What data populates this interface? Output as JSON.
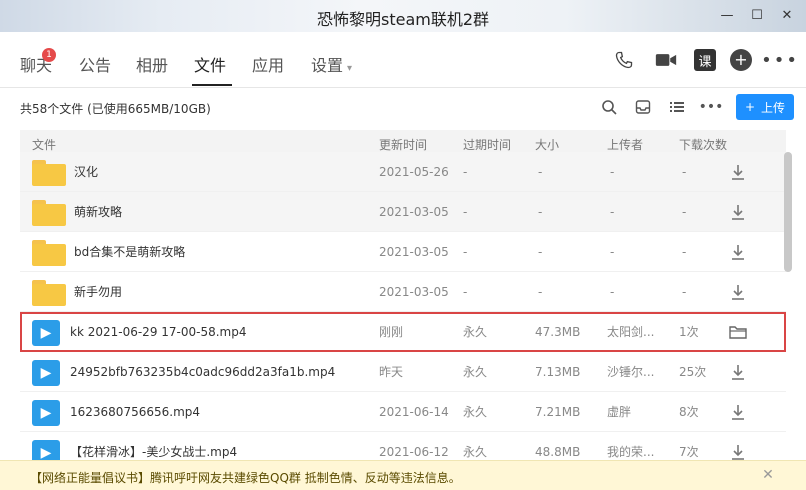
{
  "window": {
    "title": "恐怖黎明steam联机2群",
    "controls": [
      "minimize-icon",
      "maximize-icon",
      "close-icon"
    ]
  },
  "tabs": [
    {
      "label": "聊天",
      "badge": "1",
      "active": false
    },
    {
      "label": "公告",
      "active": false
    },
    {
      "label": "相册",
      "active": false
    },
    {
      "label": "文件",
      "active": true
    },
    {
      "label": "应用",
      "active": false
    },
    {
      "label": "设置",
      "active": false,
      "dropdown": true
    }
  ],
  "header_icons": {
    "phone": "phone-icon",
    "video": "video-call-icon",
    "course": {
      "icon": "course-icon",
      "label": "课"
    },
    "add": "plus-circle-icon",
    "more": "more-icon"
  },
  "toolbar": {
    "summary": "共58个文件 (已使用665MB/10GB)",
    "upload_label": "上传",
    "tools": [
      "search-icon",
      "inbox-icon",
      "list-view-icon",
      "more-icon"
    ]
  },
  "columns": {
    "file": "文件",
    "updated": "更新时间",
    "expire": "过期时间",
    "size": "大小",
    "uploader": "上传者",
    "downloads": "下载次数"
  },
  "rows": [
    {
      "type": "folder",
      "name": "汉化",
      "updated": "2021-05-26",
      "expire": "-",
      "size": "-",
      "uploader": "-",
      "downloads": "-",
      "action": "download-icon"
    },
    {
      "type": "folder",
      "name": "萌新攻略",
      "updated": "2021-03-05",
      "expire": "-",
      "size": "-",
      "uploader": "-",
      "downloads": "-",
      "action": "download-icon"
    },
    {
      "type": "folder",
      "name": "bd合集不是萌新攻略",
      "updated": "2021-03-05",
      "expire": "-",
      "size": "-",
      "uploader": "-",
      "downloads": "-",
      "action": "download-icon"
    },
    {
      "type": "folder",
      "name": "新手勿用",
      "updated": "2021-03-05",
      "expire": "-",
      "size": "-",
      "uploader": "-",
      "downloads": "-",
      "action": "download-icon"
    },
    {
      "type": "video",
      "name": "kk 2021-06-29 17-00-58.mp4",
      "updated": "刚刚",
      "expire": "永久",
      "size": "47.3MB",
      "uploader": "太阳剑...",
      "downloads": "1次",
      "action": "open-folder-icon",
      "highlight": true
    },
    {
      "type": "video",
      "name": "24952bfb763235b4c0adc96dd2a3fa1b.mp4",
      "updated": "昨天",
      "expire": "永久",
      "size": "7.13MB",
      "uploader": "沙锤尔...",
      "downloads": "25次",
      "action": "download-icon"
    },
    {
      "type": "video",
      "name": "1623680756656.mp4",
      "updated": "2021-06-14",
      "expire": "永久",
      "size": "7.21MB",
      "uploader": "虚胖",
      "downloads": "8次",
      "action": "download-icon"
    },
    {
      "type": "video",
      "name": "【花样滑冰】-美少女战士.mp4",
      "updated": "2021-06-12",
      "expire": "永久",
      "size": "48.8MB",
      "uploader": "我的荣...",
      "downloads": "7次",
      "action": "download-icon"
    }
  ],
  "notice": {
    "text": "【网络正能量倡议书】腾讯呼吁网友共建绿色QQ群 抵制色情、反动等违法信息。",
    "close_icon": "close-icon"
  },
  "colors": {
    "accent": "#1e90ff",
    "folder": "#f7c844",
    "video": "#2b9de8",
    "highlight_border": "#d94545",
    "notice_bg": "#fff7d6"
  }
}
